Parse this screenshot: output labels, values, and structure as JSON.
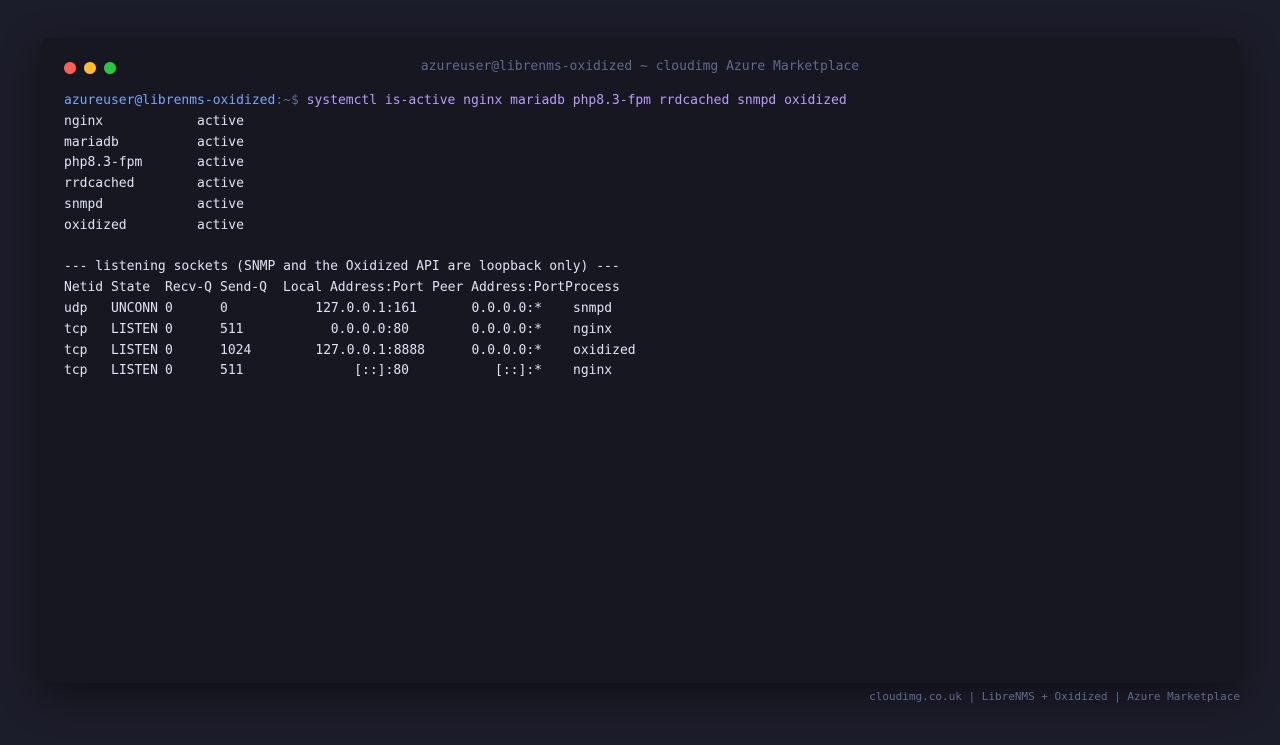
{
  "window": {
    "title": "azureuser@librenms-oxidized ~ cloudimg Azure Marketplace"
  },
  "prompt": {
    "user_host": "azureuser@librenms-oxidized",
    "path": ":~$",
    "command": "systemctl is-active nginx mariadb php8.3-fpm rrdcached snmpd oxidized"
  },
  "services": [
    {
      "name": "nginx",
      "status": "active"
    },
    {
      "name": "mariadb",
      "status": "active"
    },
    {
      "name": "php8.3-fpm",
      "status": "active"
    },
    {
      "name": "rrdcached",
      "status": "active"
    },
    {
      "name": "snmpd",
      "status": "active"
    },
    {
      "name": "oxidized",
      "status": "active"
    }
  ],
  "sockets_header": "--- listening sockets (SNMP and the Oxidized API are loopback only) ---",
  "sockets_columns": [
    "Netid",
    "State",
    "Recv-Q",
    "Send-Q",
    "Local Address:Port",
    "Peer Address:Port",
    "Process"
  ],
  "sockets": [
    {
      "netid": "udp",
      "state": "UNCONN",
      "recvq": "0",
      "sendq": "0",
      "local": "127.0.0.1:161",
      "peer": "0.0.0.0:*",
      "process": "snmpd"
    },
    {
      "netid": "tcp",
      "state": "LISTEN",
      "recvq": "0",
      "sendq": "511",
      "local": "0.0.0.0:80",
      "peer": "0.0.0.0:*",
      "process": "nginx"
    },
    {
      "netid": "tcp",
      "state": "LISTEN",
      "recvq": "0",
      "sendq": "1024",
      "local": "127.0.0.1:8888",
      "peer": "0.0.0.0:*",
      "process": "oxidized"
    },
    {
      "netid": "tcp",
      "state": "LISTEN",
      "recvq": "0",
      "sendq": "511",
      "local": "[::]:80",
      "peer": "[::]:*",
      "process": "nginx"
    }
  ],
  "footer": "cloudimg.co.uk | LibreNMS + Oxidized | Azure Marketplace",
  "colors": {
    "background": "#1c1d2a",
    "window": "#161720",
    "prompt_user": "#7aa2f7",
    "command": "#bb9af7",
    "text": "#dde1f2",
    "muted": "#5d6a8c"
  }
}
